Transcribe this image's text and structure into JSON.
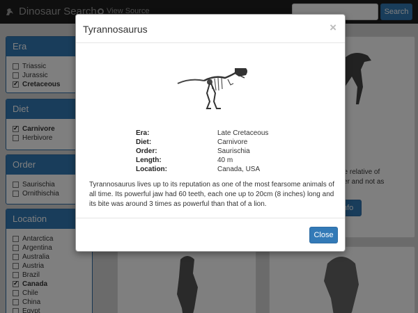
{
  "navbar": {
    "brand": "Dinosaur Search",
    "view_source": "View Source",
    "search_placeholder": "",
    "search_button": "Search"
  },
  "sidebar": {
    "era": {
      "title": "Era",
      "options": [
        {
          "label": "Triassic",
          "checked": false
        },
        {
          "label": "Jurassic",
          "checked": false
        },
        {
          "label": "Cretaceous",
          "checked": true
        }
      ]
    },
    "diet": {
      "title": "Diet",
      "options": [
        {
          "label": "Carnivore",
          "checked": true
        },
        {
          "label": "Herbivore",
          "checked": false
        }
      ]
    },
    "order": {
      "title": "Order",
      "options": [
        {
          "label": "Saurischia",
          "checked": false
        },
        {
          "label": "Ornithischia",
          "checked": false
        }
      ]
    },
    "location": {
      "title": "Location",
      "options": [
        {
          "label": "Antarctica",
          "checked": false
        },
        {
          "label": "Argentina",
          "checked": false
        },
        {
          "label": "Australia",
          "checked": false
        },
        {
          "label": "Austria",
          "checked": false
        },
        {
          "label": "Brazil",
          "checked": false
        },
        {
          "label": "Canada",
          "checked": true
        },
        {
          "label": "Chile",
          "checked": false
        },
        {
          "label": "China",
          "checked": false
        },
        {
          "label": "Egypt",
          "checked": false
        }
      ]
    }
  },
  "background": {
    "card_title_fragment": "s",
    "card_text": [
      "ose relative of",
      "aller and not as"
    ],
    "info_button": "nfo"
  },
  "modal": {
    "title": "Tyrannosaurus",
    "attributes": [
      {
        "key": "Era:",
        "value": "Late Cretaceous"
      },
      {
        "key": "Diet:",
        "value": "Carnivore"
      },
      {
        "key": "Order:",
        "value": "Saurischia"
      },
      {
        "key": "Length:",
        "value": "40 m"
      },
      {
        "key": "Location:",
        "value": "Canada, USA"
      }
    ],
    "description": "Tyrannosaurus lives up to its reputation as one of the most fearsome animals of all time. Its powerful jaw had 60 teeth, each one up to 20cm (8 inches) long and its bite was around 3 times as powerful than that of a lion.",
    "close_button": "Close",
    "close_icon": "×"
  },
  "colors": {
    "primary": "#337ab7",
    "navbar": "#1e1e1e"
  }
}
